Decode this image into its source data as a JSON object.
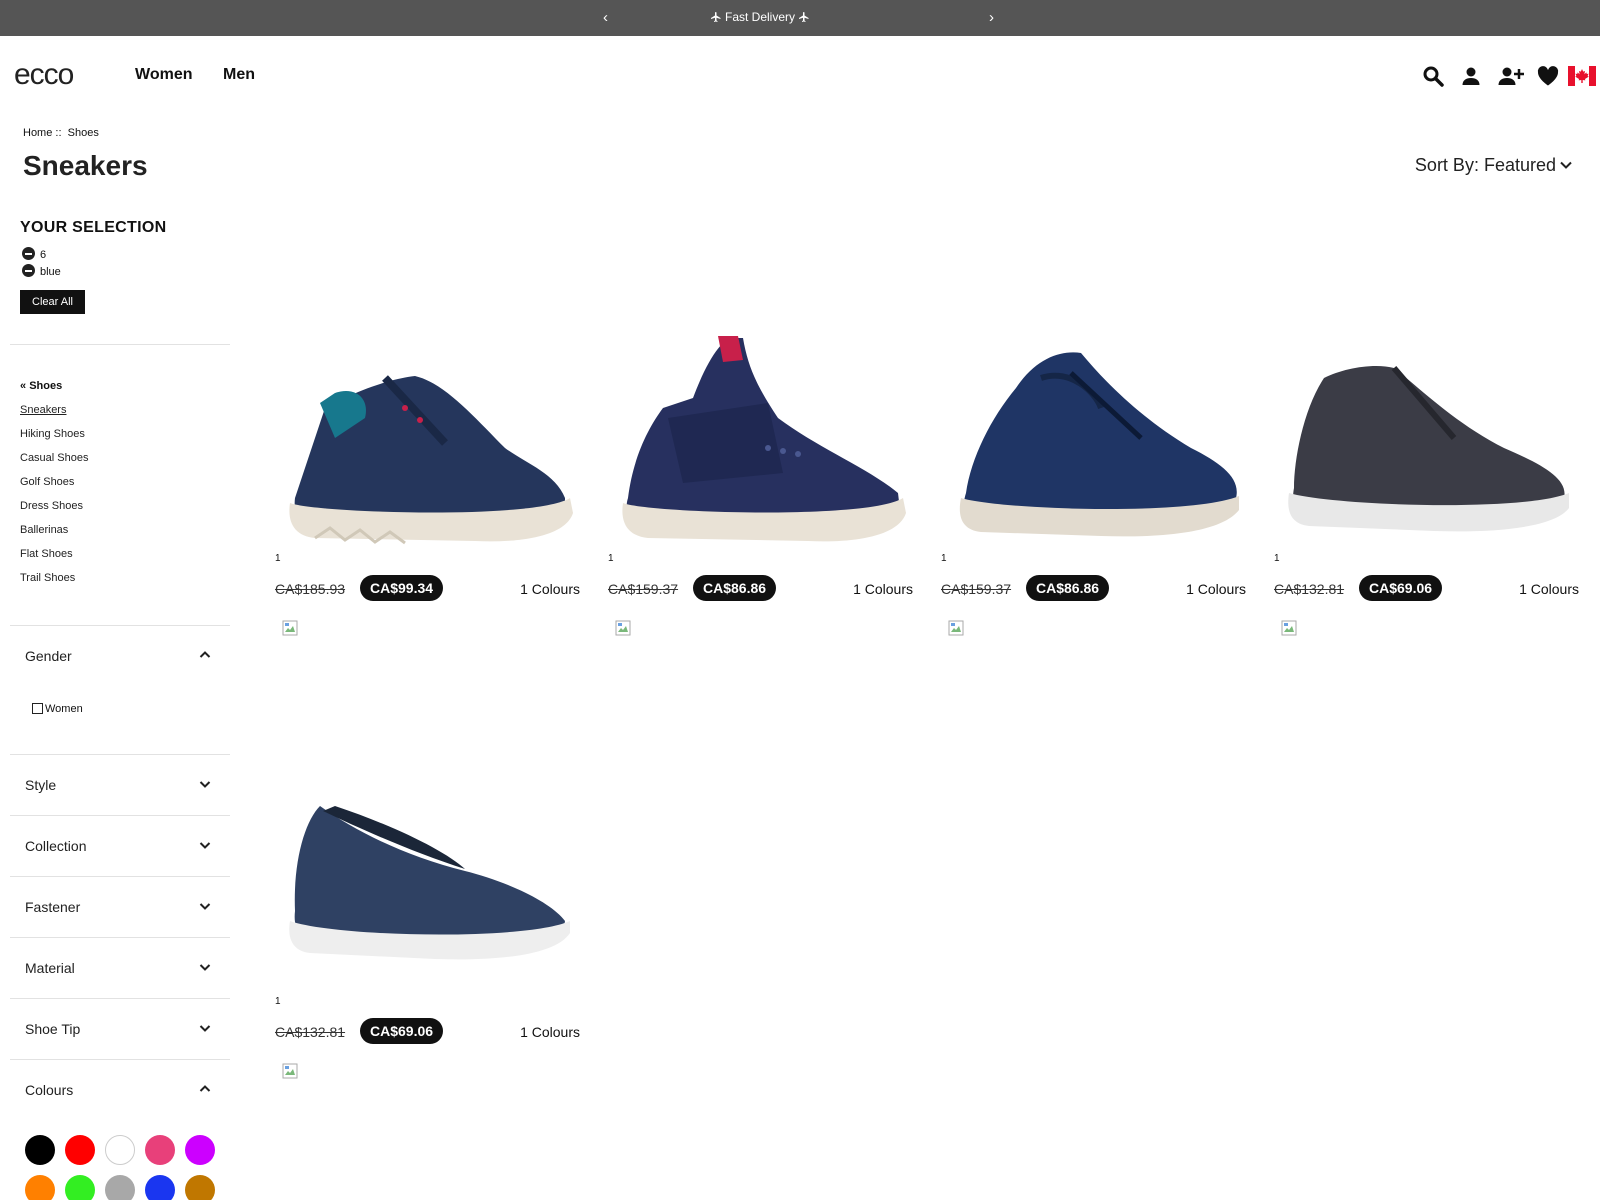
{
  "promo": {
    "prev_label": "‹",
    "next_label": "›",
    "message": "Fast Delivery"
  },
  "header": {
    "logo_text": "ecco",
    "nav": [
      "Women",
      "Men"
    ],
    "icons": [
      "search-icon",
      "account-icon",
      "add-user-icon",
      "wishlist-heart-icon",
      "canada-flag-icon"
    ]
  },
  "breadcrumb": {
    "home": "Home",
    "separator": "::",
    "current": "Shoes"
  },
  "page": {
    "title": "Sneakers",
    "sort_label": "Sort By: Featured"
  },
  "selection": {
    "title": "YOUR SELECTION",
    "items": [
      "6",
      "blue"
    ],
    "clear_label": "Clear All"
  },
  "categories": {
    "parent": "Shoes",
    "links": [
      "Sneakers",
      "Hiking Shoes",
      "Casual Shoes",
      "Golf Shoes",
      "Dress Shoes",
      "Ballerinas",
      "Flat Shoes",
      "Trail Shoes"
    ],
    "active": "Sneakers"
  },
  "facets": {
    "gender": {
      "label": "Gender",
      "expanded": true,
      "options": [
        "Women"
      ]
    },
    "style": {
      "label": "Style"
    },
    "collection": {
      "label": "Collection"
    },
    "fastener": {
      "label": "Fastener"
    },
    "material": {
      "label": "Material"
    },
    "shoe_tip": {
      "label": "Shoe Tip"
    },
    "colours": {
      "label": "Colours",
      "expanded": true
    }
  },
  "colour_swatches": [
    "#000000",
    "#ff0000",
    "#ffffff",
    "#e8407a",
    "#cc00ff",
    "#ff8000",
    "#33ee22",
    "#a8a8a8",
    "#1a36f0",
    "#c07700"
  ],
  "products": [
    {
      "count": "1",
      "old_price": "CA$185.93",
      "price": "CA$99.34",
      "colours": "1 Colours",
      "shoe": "sneaker-mesh-navy"
    },
    {
      "count": "1",
      "old_price": "CA$159.37",
      "price": "CA$86.86",
      "colours": "1 Colours",
      "shoe": "sneaker-strap-navy"
    },
    {
      "count": "1",
      "old_price": "CA$159.37",
      "price": "CA$86.86",
      "colours": "1 Colours",
      "shoe": "sneaker-leather-navy"
    },
    {
      "count": "1",
      "old_price": "CA$132.81",
      "price": "CA$69.06",
      "colours": "1 Colours",
      "shoe": "sneaker-lowcut-dark"
    },
    {
      "count": "1",
      "old_price": "CA$132.81",
      "price": "CA$69.06",
      "colours": "1 Colours",
      "shoe": "ballerina-slipon-navy"
    }
  ]
}
